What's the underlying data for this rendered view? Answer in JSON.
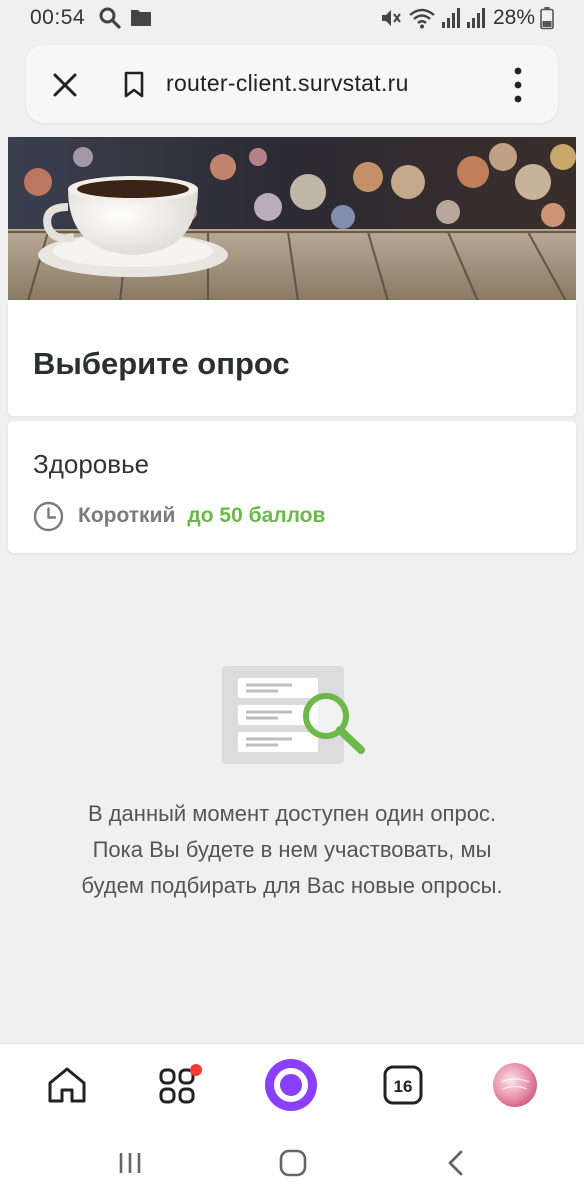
{
  "status_bar": {
    "time": "00:54",
    "battery": "28%"
  },
  "browser": {
    "url": "router-client.survstat.ru"
  },
  "page": {
    "heading": "Выберите опрос",
    "survey": {
      "name": "Здоровье",
      "duration": "Короткий",
      "points": "до 50 баллов"
    },
    "message": "В данный момент доступен один опрос. Пока Вы будете в нем участвовать, мы будем подбирать для Вас новые опросы."
  },
  "bottom_nav": {
    "tabs_count": "16"
  },
  "colors": {
    "accent_green": "#6cb84a",
    "alice_purple": "#8a3ffc",
    "notification_red": "#ff3b30"
  }
}
